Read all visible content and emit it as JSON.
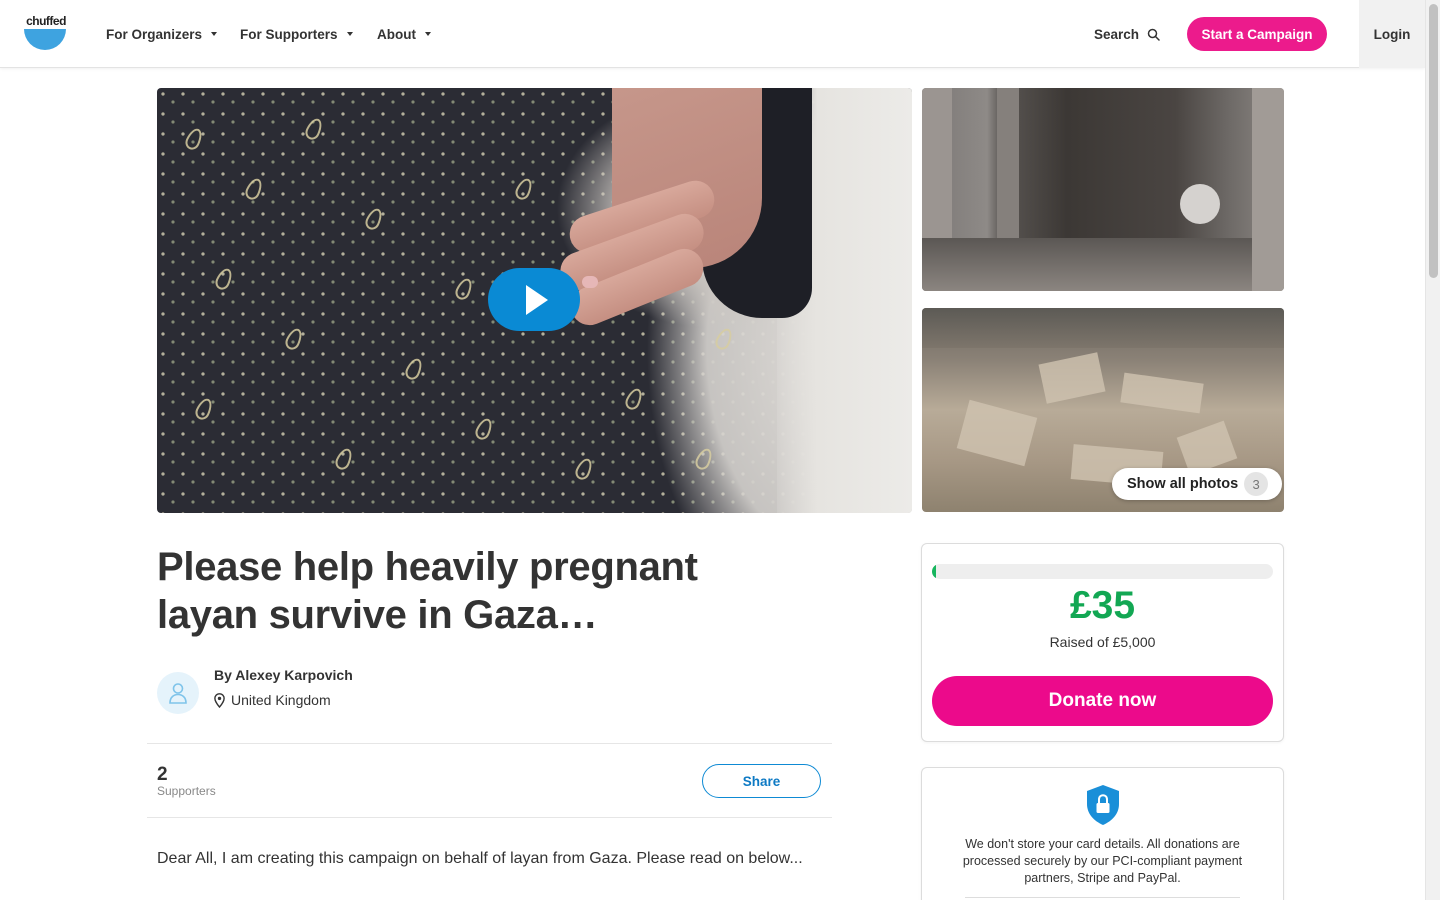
{
  "header": {
    "logo_text": "chuffed",
    "nav": [
      {
        "label": "For Organizers"
      },
      {
        "label": "For Supporters"
      },
      {
        "label": "About"
      }
    ],
    "search_label": "Search",
    "start_campaign_label": "Start a Campaign",
    "login_label": "Login",
    "brand_color": "#ec1b8c"
  },
  "gallery": {
    "show_all_label": "Show all photos",
    "photo_count": "3"
  },
  "campaign": {
    "title": "Please help heavily pregnant layan survive in Gaza…",
    "author": "By Alexey Karpovich",
    "location": "United Kingdom",
    "supporters_count": "2",
    "supporters_label": "Supporters",
    "share_label": "Share",
    "description": "Dear All, I am creating this campaign on behalf of layan from Gaza. Please read on below..."
  },
  "donation": {
    "raised": "£35",
    "goal_text": "Raised of £5,000",
    "progress_fraction": 0.007,
    "donate_label": "Donate now",
    "secure_text": "We don't store your card details. All donations are processed securely by our PCI-compliant payment partners, Stripe and PayPal.",
    "accent_color": "#12a753"
  }
}
